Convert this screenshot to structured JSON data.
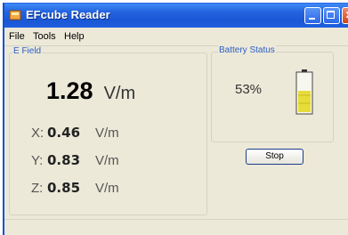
{
  "window": {
    "title": "EFcube Reader"
  },
  "menu": [
    "File",
    "Tools",
    "Help"
  ],
  "efield": {
    "group_label": "E Field",
    "magnitude": "1.28",
    "unit": "V/m",
    "axes": [
      {
        "label": "X:",
        "value": "0.46",
        "unit": "V/m"
      },
      {
        "label": "Y:",
        "value": "0.83",
        "unit": "V/m"
      },
      {
        "label": "Z:",
        "value": "0.85",
        "unit": "V/m"
      }
    ]
  },
  "battery": {
    "group_label": "Battery Status",
    "percent_text": "53%",
    "level": 0.53,
    "fill_color": "#e8dc3a"
  },
  "controls": {
    "stop_label": "Stop"
  },
  "colors": {
    "titlebar": "#2463df",
    "group_label": "#2b5ec7",
    "window_bg": "#ece9d8"
  }
}
